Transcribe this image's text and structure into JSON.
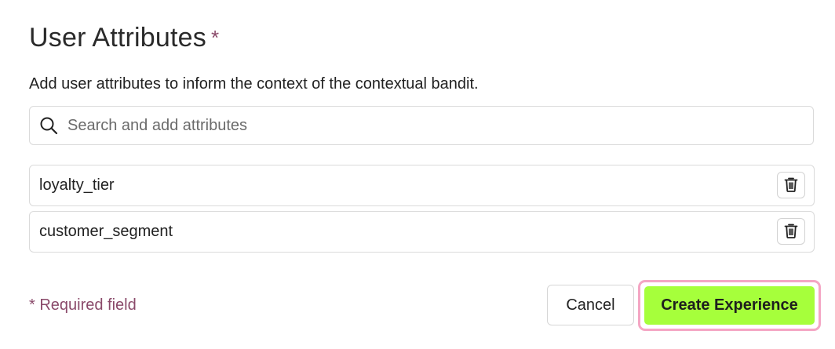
{
  "section": {
    "title": "User Attributes",
    "required_marker": "*",
    "description": "Add user attributes to inform the context of the contextual bandit."
  },
  "search": {
    "placeholder": "Search and add attributes",
    "value": "",
    "icon": "search-icon"
  },
  "attributes": [
    {
      "label": "loyalty_tier",
      "delete_icon": "trash-icon"
    },
    {
      "label": "customer_segment",
      "delete_icon": "trash-icon"
    }
  ],
  "footer": {
    "required_note": "* Required field",
    "cancel_label": "Cancel",
    "create_label": "Create Experience"
  },
  "colors": {
    "accent_button": "#a6ff3b",
    "focus_ring": "#f4a6c4",
    "required_text": "#8a4a6a"
  }
}
